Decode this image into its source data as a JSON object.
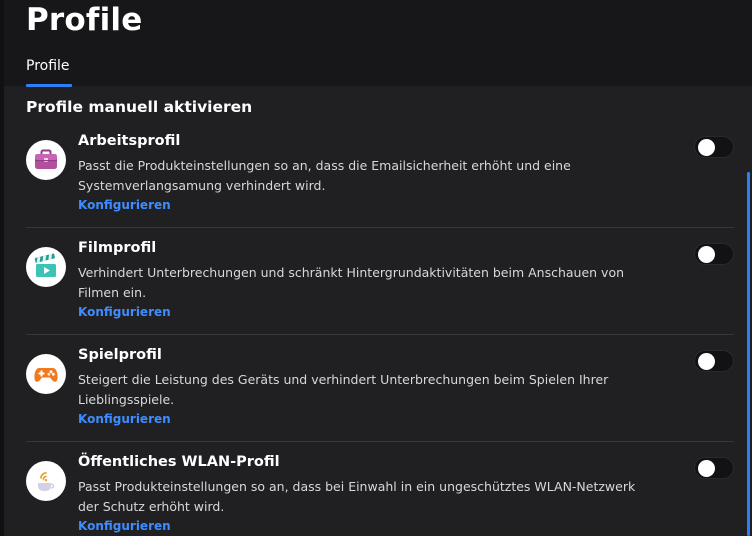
{
  "header": {
    "title": "Profile",
    "tabs": [
      {
        "label": "Profile",
        "active": true
      }
    ]
  },
  "section": {
    "title": "Profile manuell aktivieren"
  },
  "profiles": [
    {
      "name": "Arbeitsprofil",
      "description": "Passt die Produkteinstellungen so an, dass die Emailsicherheit erhöht und eine Systemverlangsamung verhindert wird.",
      "action": "Konfigurieren",
      "enabled": false,
      "icon": "briefcase-icon"
    },
    {
      "name": "Filmprofil",
      "description": "Verhindert Unterbrechungen und schränkt Hintergrundaktivitäten beim Anschauen von Filmen ein.",
      "action": "Konfigurieren",
      "enabled": false,
      "icon": "clapperboard-icon"
    },
    {
      "name": "Spielprofil",
      "description": "Steigert die Leistung des Geräts und verhindert Unterbrechungen beim Spielen Ihrer Lieblingsspiele.",
      "action": "Konfigurieren",
      "enabled": false,
      "icon": "gamepad-icon"
    },
    {
      "name": "Öffentliches WLAN-Profil",
      "description": "Passt Produkteinstellungen so an, dass bei Einwahl in ein ungeschütztes WLAN-Netzwerk der Schutz erhöht wird.",
      "action": "Konfigurieren",
      "enabled": false,
      "icon": "wifi-cup-icon"
    }
  ],
  "colors": {
    "accent": "#2d7ff9",
    "link": "#3f8cff",
    "background": "#202023",
    "header_background": "#17171a"
  }
}
